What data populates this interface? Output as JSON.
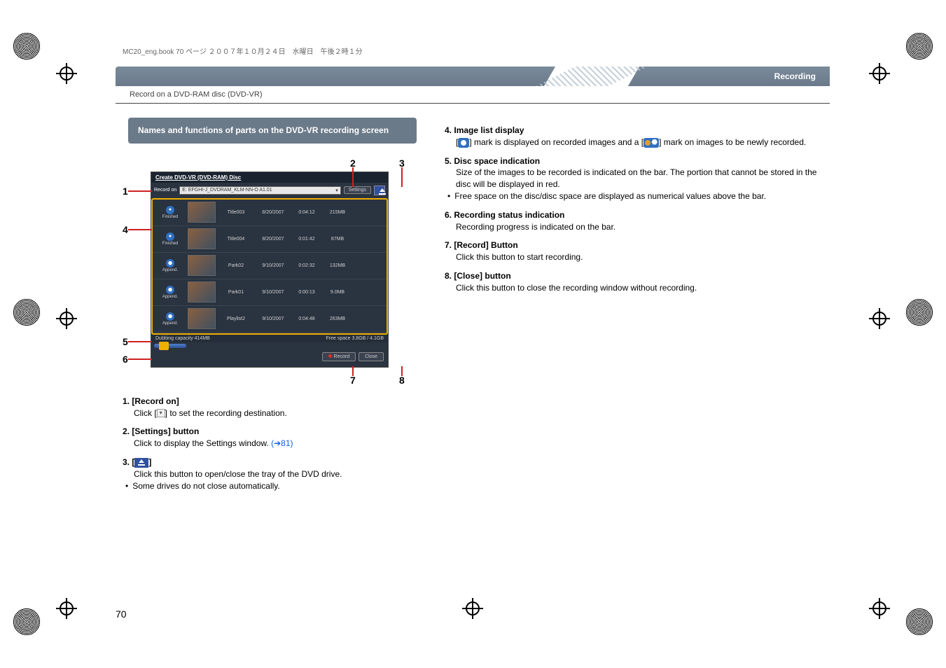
{
  "header_line": "MC20_eng.book  70 ページ  ２００７年１０月２４日　水曜日　午後２時１分",
  "tab_label": "Recording",
  "breadcrumb": "Record on a DVD-RAM disc (DVD-VR)",
  "callout": "Names and functions of parts on the DVD-VR recording screen",
  "page_number": "70",
  "labels": {
    "n1": "1",
    "n2": "2",
    "n3": "3",
    "n4": "4",
    "n5": "5",
    "n6": "6",
    "n7": "7",
    "n8": "8"
  },
  "app": {
    "title": "Create DVD-VR (DVD-RAM) Disc",
    "record_on_label": "Record on",
    "drive": "E: EFGHI-J_DVDRAM_KLM-NN-O A1.01",
    "settings": "Settings",
    "rows": [
      {
        "status": "Finished",
        "title": "Title003",
        "date": "8/20/2007",
        "dur": "0:04:12",
        "size": "215MB"
      },
      {
        "status": "Finished",
        "title": "Title004",
        "date": "8/20/2007",
        "dur": "0:01:42",
        "size": "87MB"
      },
      {
        "status": "Append.",
        "title": "Park02",
        "date": "9/10/2007",
        "dur": "0:02:32",
        "size": "132MB"
      },
      {
        "status": "Append.",
        "title": "Park01",
        "date": "9/10/2007",
        "dur": "0:00:13",
        "size": "9.0MB"
      },
      {
        "status": "Append.",
        "title": "Playlist2",
        "date": "9/10/2007",
        "dur": "0:04:48",
        "size": "263MB"
      }
    ],
    "capacity_label": "Dubbing capacity  414MB",
    "freespace_label": "Free space  3.8GB / 4.1GB",
    "record_btn": "Record",
    "close_btn": "Close"
  },
  "left_items": [
    {
      "num": "1.",
      "title": "[Record on]",
      "body": "Click [",
      "body2": "] to set the recording destination."
    },
    {
      "num": "2.",
      "title": "[Settings] button",
      "body": "Click to display the Settings window. ",
      "link": "(➔81)"
    },
    {
      "num": "3.",
      "title_prefix": "[",
      "title_suffix": "]",
      "body": "Click this button to open/close the tray of the DVD drive.",
      "bullet": "Some drives do not close automatically."
    }
  ],
  "right_items": [
    {
      "num": "4.",
      "title": "Image list display",
      "body1": "[",
      "body2": "] mark is displayed on recorded images and a [",
      "body3": "] mark on images to be newly recorded."
    },
    {
      "num": "5.",
      "title": "Disc space indication",
      "body": "Size of the images to be recorded is indicated on the bar. The portion that cannot be stored in the disc will be displayed in red.",
      "bullet": "Free space on the disc/disc space are displayed as numerical values above the bar."
    },
    {
      "num": "6.",
      "title": "Recording status indication",
      "body": "Recording progress is indicated on the bar."
    },
    {
      "num": "7.",
      "title": "[Record] Button",
      "body": "Click this button to start recording."
    },
    {
      "num": "8.",
      "title": "[Close] button",
      "body": "Click this button to close the recording window without recording."
    }
  ]
}
